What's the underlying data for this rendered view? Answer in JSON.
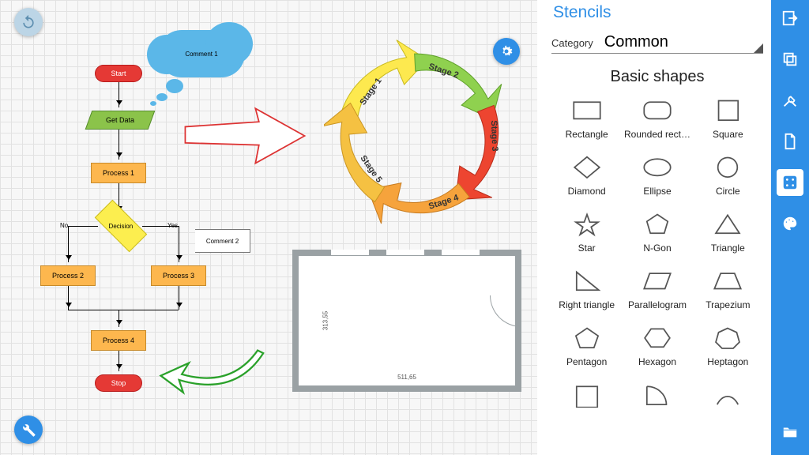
{
  "canvas": {
    "flowchart": {
      "start": "Start",
      "get_data": "Get Data",
      "process1": "Process 1",
      "decision": "Decision",
      "yes_label": "Yes",
      "no_label": "No",
      "process2": "Process 2",
      "process3": "Process 3",
      "process4": "Process 4",
      "stop": "Stop",
      "comment1": "Comment 1",
      "comment2": "Comment 2"
    },
    "cycle": {
      "stage1": "Stage 1",
      "stage2": "Stage 2",
      "stage3": "Stage 3",
      "stage4": "Stage 4",
      "stage5": "Stage 5"
    },
    "floorplan": {
      "width_label": "511,65",
      "height_label": "313,55"
    }
  },
  "stencils": {
    "title": "Stencils",
    "category_label": "Category",
    "category_value": "Common",
    "section_title": "Basic shapes",
    "shapes": [
      "Rectangle",
      "Rounded rect…",
      "Square",
      "Diamond",
      "Ellipse",
      "Circle",
      "Star",
      "N-Gon",
      "Triangle",
      "Right triangle",
      "Parallelogram",
      "Trapezium",
      "Pentagon",
      "Hexagon",
      "Heptagon",
      "",
      "",
      ""
    ]
  },
  "toolbar": {
    "items": [
      "export-icon",
      "copy-icon",
      "tools-icon",
      "file-icon",
      "stencils-icon",
      "palette-icon"
    ],
    "active_index": 4,
    "bottom_item": "folder-icon"
  },
  "fabs": {
    "undo": "undo-icon",
    "settings": "gear-icon",
    "wrench": "wrench-icon"
  }
}
